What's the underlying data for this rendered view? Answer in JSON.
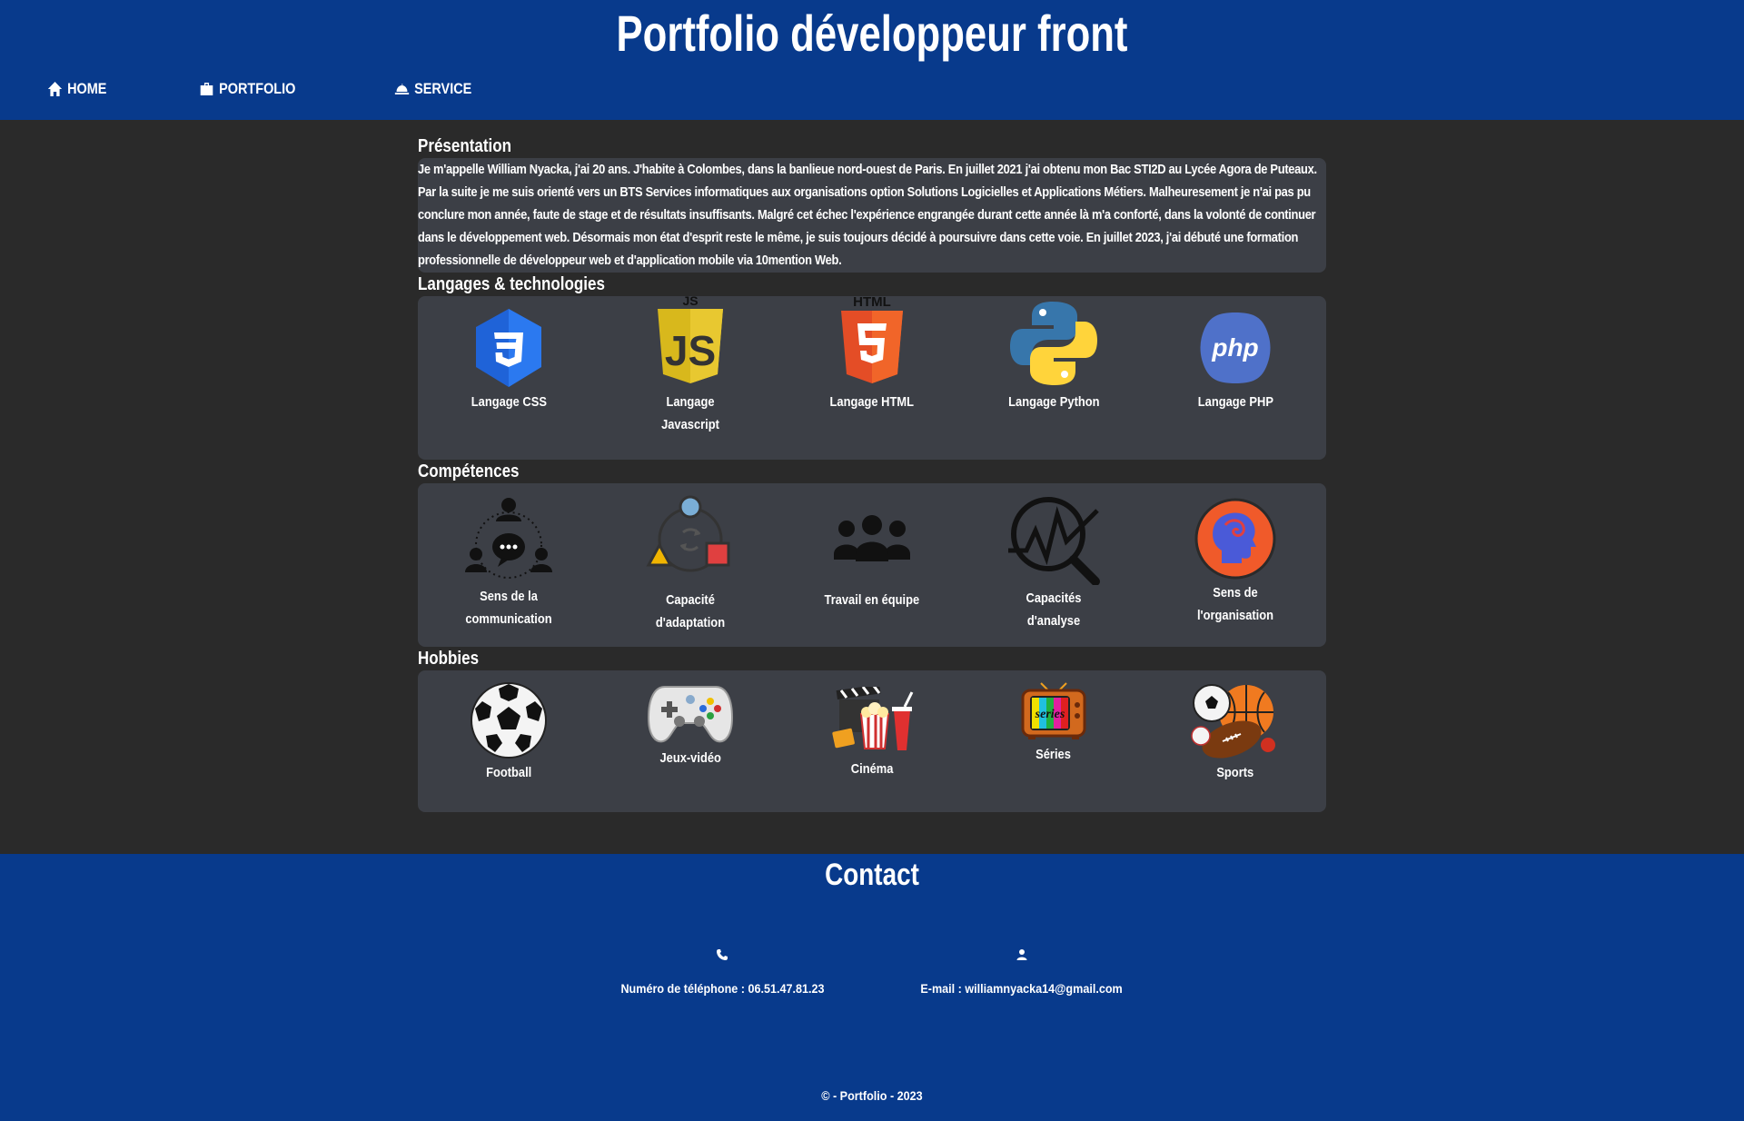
{
  "header": {
    "title": "Portfolio développeur front",
    "nav": [
      {
        "label": "HOME",
        "icon": "home-icon"
      },
      {
        "label": "PORTFOLIO",
        "icon": "briefcase-icon"
      },
      {
        "label": "SERVICE",
        "icon": "service-bell-icon"
      }
    ]
  },
  "presentation": {
    "title": "Présentation",
    "text": "Je m'appelle William Nyacka, j'ai 20 ans. J'habite à Colombes, dans la banlieue nord-ouest de Paris. En juillet 2021 j'ai obtenu mon Bac STI2D au Lycée Agora de Puteaux. Par la suite je me suis orienté vers un BTS Services informatiques aux organisations option Solutions Logicielles et Applications Métiers. Malheuresement je n'ai pas pu conclure mon année, faute de stage et de résultats insuffisants. Malgré cet échec l'expérience engrangée durant cette année là m'a conforté, dans la volonté de continuer dans le développement web. Désormais mon état d'esprit reste le même, je suis toujours décidé à poursuivre dans cette voie. En juillet 2023, j'ai débuté une formation professionnelle de développeur web et d'application mobile via 10mention Web."
  },
  "languages": {
    "title": "Langages & technologies",
    "items": [
      {
        "label": "Langage CSS",
        "icon": "css3-icon",
        "color": "#1f63d8"
      },
      {
        "label": "Langage Javascript",
        "icon": "javascript-icon",
        "color": "#d8b81c"
      },
      {
        "label": "Langage HTML",
        "icon": "html5-icon",
        "color": "#e44d26"
      },
      {
        "label": "Langage Python",
        "icon": "python-icon",
        "color": "#3776ab"
      },
      {
        "label": "Langage PHP",
        "icon": "php-icon",
        "color": "#4f5da3"
      }
    ]
  },
  "skills": {
    "title": "Compétences",
    "items": [
      {
        "label": "Sens de la communication",
        "icon": "communication-icon"
      },
      {
        "label": "Capacité d'adaptation",
        "icon": "adaptation-icon"
      },
      {
        "label": "Travail en équipe",
        "icon": "team-icon"
      },
      {
        "label": "Capacités d'analyse",
        "icon": "analysis-icon"
      },
      {
        "label": "Sens de l'organisation",
        "icon": "organization-icon"
      }
    ]
  },
  "hobbies": {
    "title": "Hobbies",
    "items": [
      {
        "label": "Football",
        "icon": "soccer-ball-icon"
      },
      {
        "label": "Jeux-vidéo",
        "icon": "gamepad-icon"
      },
      {
        "label": "Cinéma",
        "icon": "cinema-icon"
      },
      {
        "label": "Séries",
        "icon": "tv-icon",
        "badge": "series"
      },
      {
        "label": "Sports",
        "icon": "sports-balls-icon"
      }
    ]
  },
  "contact": {
    "title": "Contact",
    "phone": "Numéro de téléphone : 06.51.47.81.23",
    "email": "E-mail : williamnyacka14@gmail.com"
  },
  "footer": {
    "copyright": "© - Portfolio - 2023"
  }
}
